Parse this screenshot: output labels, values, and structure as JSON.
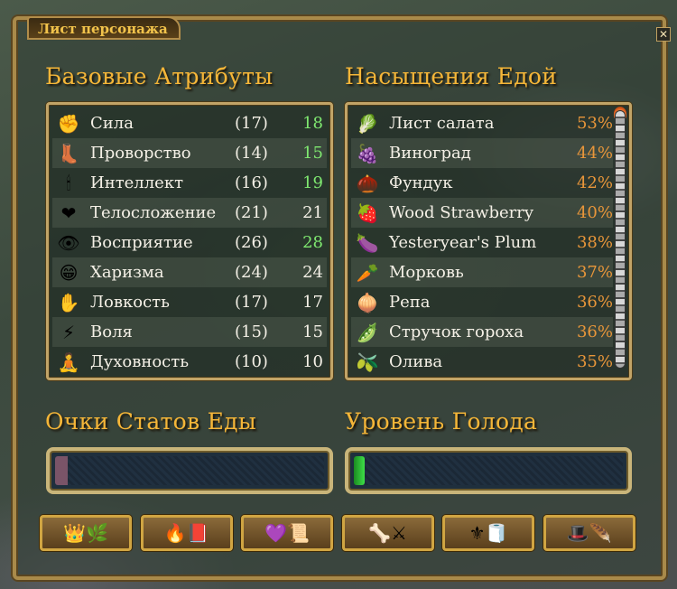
{
  "window": {
    "title": "Лист персонажа",
    "close_glyph": "✕"
  },
  "attributes": {
    "heading": "Базовые Атрибуты",
    "rows": [
      {
        "icon": "fist-icon",
        "glyph": "✊",
        "name": "Сила",
        "base": "(17)",
        "current": "18",
        "boosted": true
      },
      {
        "icon": "boot-icon",
        "glyph": "👢",
        "name": "Проворство",
        "base": "(14)",
        "current": "15",
        "boosted": true
      },
      {
        "icon": "candle-icon",
        "glyph": "🕯",
        "name": "Интеллект",
        "base": "(16)",
        "current": "19",
        "boosted": true
      },
      {
        "icon": "heart-icon",
        "glyph": "❤",
        "name": "Телосложение",
        "base": "(21)",
        "current": "21",
        "boosted": false
      },
      {
        "icon": "eye-icon",
        "glyph": "👁",
        "name": "Восприятие",
        "base": "(26)",
        "current": "28",
        "boosted": true
      },
      {
        "icon": "smile-icon",
        "glyph": "😁",
        "name": "Харизма",
        "base": "(24)",
        "current": "24",
        "boosted": false
      },
      {
        "icon": "hand-icon",
        "glyph": "✋",
        "name": "Ловкость",
        "base": "(17)",
        "current": "17",
        "boosted": false
      },
      {
        "icon": "lightning-icon",
        "glyph": "⚡",
        "name": "Воля",
        "base": "(15)",
        "current": "15",
        "boosted": false
      },
      {
        "icon": "monk-icon",
        "glyph": "🧘",
        "name": "Духовность",
        "base": "(10)",
        "current": "10",
        "boosted": false
      }
    ]
  },
  "food": {
    "heading": "Насыщения Едой",
    "rows": [
      {
        "icon": "lettuce-icon",
        "glyph": "🥬",
        "name": "Лист салата",
        "pct": "53%"
      },
      {
        "icon": "grapes-icon",
        "glyph": "🍇",
        "name": "Виноград",
        "pct": "44%"
      },
      {
        "icon": "hazelnut-icon",
        "glyph": "🌰",
        "name": "Фундук",
        "pct": "42%"
      },
      {
        "icon": "strawberry-icon",
        "glyph": "🍓",
        "name": "Wood Strawberry",
        "pct": "40%"
      },
      {
        "icon": "plum-icon",
        "glyph": "🍆",
        "name": "Yesteryear's Plum",
        "pct": "38%"
      },
      {
        "icon": "carrot-icon",
        "glyph": "🥕",
        "name": "Морковь",
        "pct": "37%"
      },
      {
        "icon": "turnip-icon",
        "glyph": "🧅",
        "name": "Репа",
        "pct": "36%"
      },
      {
        "icon": "peapod-icon",
        "glyph": "🫛",
        "name": "Стручок гороха",
        "pct": "36%"
      },
      {
        "icon": "olive-icon",
        "glyph": "🫒",
        "name": "Олива",
        "pct": "35%"
      }
    ]
  },
  "food_stat_points": {
    "heading": "Очки Статов Еды",
    "fraction": 0.0
  },
  "hunger_level": {
    "heading": "Уровень Голода",
    "fraction": 0.03
  },
  "tabs": [
    {
      "icon": "crown-icon",
      "glyphs": "👑🌿"
    },
    {
      "icon": "book-icon",
      "glyphs": "🔥📕"
    },
    {
      "icon": "scroll-icon",
      "glyphs": "💜📜"
    },
    {
      "icon": "bone-icon",
      "glyphs": "🦴⚔"
    },
    {
      "icon": "bell-icon",
      "glyphs": "⚜🧻"
    },
    {
      "icon": "quill-icon",
      "glyphs": "🎩🪶"
    }
  ],
  "colors": {
    "heading": "#f5b638",
    "boosted": "#7fe870",
    "percent": "#e8963a",
    "hunger_fill": "#3fe048"
  }
}
